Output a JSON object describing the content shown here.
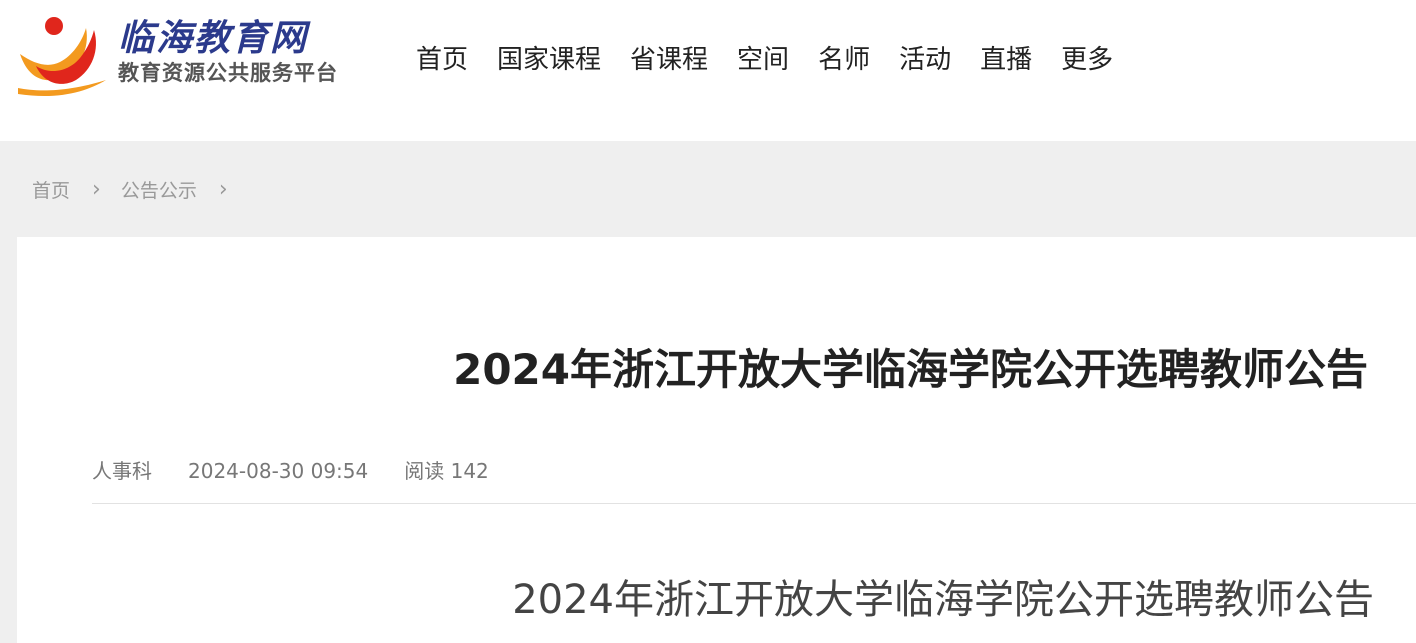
{
  "brand": {
    "title": "临海教育网",
    "subtitle": "教育资源公共服务平台",
    "colors": {
      "navy": "#2b3a8c",
      "red": "#e0261c",
      "orange": "#f39a1f"
    }
  },
  "nav": {
    "items": [
      {
        "label": "首页"
      },
      {
        "label": "国家课程"
      },
      {
        "label": "省课程"
      },
      {
        "label": "空间"
      },
      {
        "label": "名师"
      },
      {
        "label": "活动"
      },
      {
        "label": "直播"
      },
      {
        "label": "更多"
      }
    ]
  },
  "breadcrumb": {
    "items": [
      {
        "label": "首页"
      },
      {
        "label": "公告公示"
      }
    ],
    "separator": "›"
  },
  "article": {
    "title": "2024年浙江开放大学临海学院公开选聘教师公告",
    "author": "人事科",
    "datetime": "2024-08-30 09:54",
    "views_label": "阅读 142",
    "body_title": "2024年浙江开放大学临海学院公开选聘教师公告"
  }
}
